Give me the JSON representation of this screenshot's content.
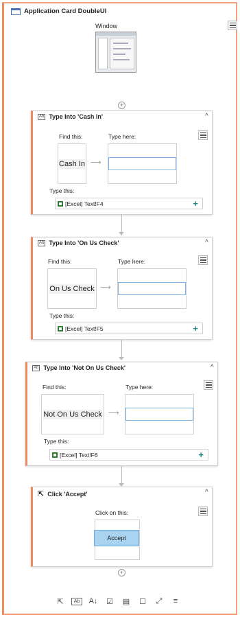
{
  "container": {
    "title": "Application Card DoubleUI",
    "window_label": "Window"
  },
  "cards": [
    {
      "title": "Type Into 'Cash In'",
      "find_label": "Find this:",
      "type_here_label": "Type here:",
      "find_text": "Cash In",
      "type_this_label": "Type this:",
      "value": "[Excel] Text!F4"
    },
    {
      "title": "Type Into 'On Us Check'",
      "find_label": "Find this:",
      "type_here_label": "Type here:",
      "find_text": "On Us Check",
      "type_this_label": "Type this:",
      "value": "[Excel] Text!F5"
    },
    {
      "title": "Type Into 'Not On Us Check'",
      "find_label": "Find this:",
      "type_here_label": "Type here:",
      "find_text": "Not On Us Check",
      "type_this_label": "Type this:",
      "value": "[Excel] Text!F6"
    },
    {
      "title": "Click 'Accept'",
      "click_label": "Click on this:",
      "target_text": "Accept"
    }
  ],
  "toolbar": {
    "icons": [
      "click-icon",
      "type-into-icon",
      "get-text-icon",
      "check-icon",
      "select-item-icon",
      "hover-icon",
      "find-element-icon",
      "list-icon"
    ],
    "glyphs": [
      "⇱",
      "Ab",
      "A↓",
      "☑",
      "▤",
      "☐",
      "⤢",
      "≡"
    ]
  },
  "colors": {
    "accent": "#ef8a5e",
    "highlight": "#a8d4f2",
    "add": "#1a8a8a"
  }
}
